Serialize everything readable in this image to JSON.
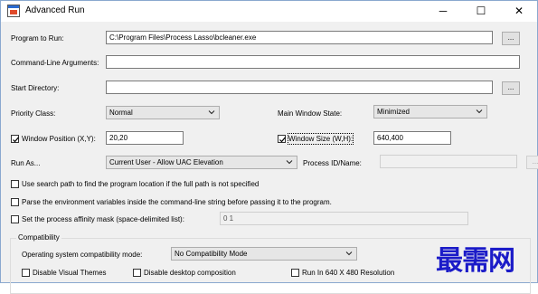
{
  "window": {
    "title": "Advanced Run",
    "minimize_glyph": "─",
    "maximize_glyph": "☐",
    "close_glyph": "✕"
  },
  "program": {
    "label": "Program to Run:",
    "value": "C:\\Program Files\\Process Lasso\\bcleaner.exe",
    "browse_label": "..."
  },
  "arguments": {
    "label": "Command-Line Arguments:",
    "value": ""
  },
  "start_directory": {
    "label": "Start Directory:",
    "value": "",
    "browse_label": "..."
  },
  "priority": {
    "label": "Priority Class:",
    "selected": "Normal"
  },
  "window_state": {
    "label": "Main Window State:",
    "selected": "Minimized"
  },
  "window_position": {
    "label": "Window Position (X,Y):",
    "checked": true,
    "value": "20,20"
  },
  "window_size": {
    "label": "Window Size (W,H):",
    "checked": true,
    "value": "640,400"
  },
  "run_as": {
    "label": "Run As...",
    "selected": "Current User - Allow UAC Elevation",
    "process_label": "Process ID/Name:",
    "process_value": "",
    "browse_label": "..."
  },
  "options": {
    "search_path": "Use search path to find the program location if the full path is not specified",
    "parse_env": "Parse the environment variables inside the command-line string before passing it to the program.",
    "affinity": "Set the process affinity mask (space-delimited list):",
    "affinity_value": "0 1"
  },
  "compatibility": {
    "group_title": "Compatibility",
    "mode_label": "Operating system compatibility mode:",
    "mode_selected": "No Compatibility Mode",
    "disable_themes": "Disable Visual Themes",
    "disable_composition": "Disable desktop composition",
    "run_640": "Run In 640 X 480 Resolution"
  },
  "watermark": "最需网",
  "colors": {
    "window_bg": "#f0f0f0",
    "border": "#8aa8cf",
    "watermark": "#1b1bc8"
  }
}
